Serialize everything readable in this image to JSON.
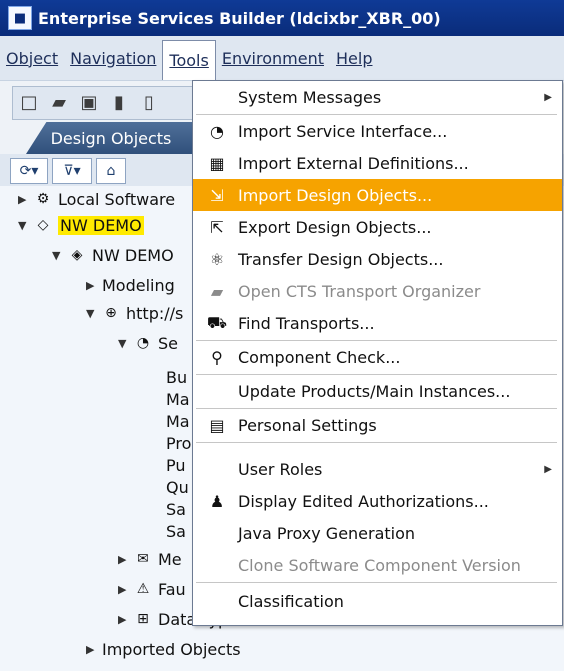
{
  "titlebar": {
    "title": "Enterprise Services Builder (ldcixbr_XBR_00)"
  },
  "menubar": [
    "Object",
    "Navigation",
    "Tools",
    "Environment",
    "Help"
  ],
  "tab": {
    "label": "Design Objects"
  },
  "tree": {
    "local_software": "Local Software",
    "nw_demo": "NW DEMO",
    "nw_demo_child": "NW DEMO",
    "modeling": "Modeling",
    "namespace": "http://s",
    "service": "Se",
    "leafs": [
      "Bu",
      "Ma",
      "Ma",
      "Pro",
      "Pu",
      "Qu",
      "Sa",
      "Sa"
    ],
    "message_types": "Me",
    "fault": "Fau",
    "data_types": "Data Types",
    "imported_objects": "Imported Objects"
  },
  "menu": {
    "items": [
      {
        "label": "System Messages",
        "submenu": true
      },
      {
        "label": "Import Service Interface...",
        "icon": "import-service-interface-icon"
      },
      {
        "label": "Import External Definitions...",
        "icon": "import-external-definitions-icon"
      },
      {
        "label": "Import Design Objects...",
        "icon": "import-design-objects-icon",
        "highlight": true
      },
      {
        "label": "Export Design Objects...",
        "icon": "export-design-objects-icon"
      },
      {
        "label": "Transfer Design Objects...",
        "icon": "transfer-design-objects-icon"
      },
      {
        "label": "Open CTS Transport Organizer",
        "icon": "open-cts-icon",
        "disabled": true
      },
      {
        "label": "Find Transports...",
        "icon": "find-transports-icon"
      },
      {
        "label": "Component Check...",
        "icon": "component-check-icon"
      },
      {
        "label": "Update Products/Main Instances..."
      },
      {
        "label": "Personal Settings",
        "icon": "personal-settings-icon"
      },
      {
        "label": "User Roles",
        "submenu": true
      },
      {
        "label": "Display Edited Authorizations...",
        "icon": "display-edited-authorizations-icon"
      },
      {
        "label": "Java Proxy Generation"
      },
      {
        "label": "Clone Software Component Version",
        "disabled": true
      },
      {
        "label": "Classification"
      }
    ]
  }
}
